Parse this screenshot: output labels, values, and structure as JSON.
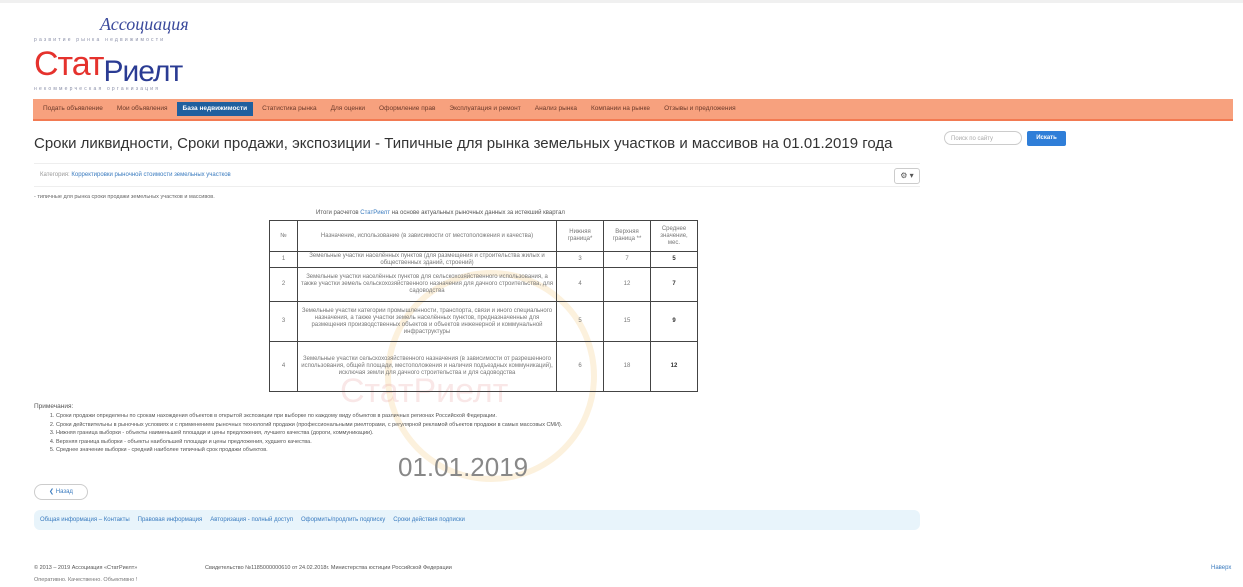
{
  "logo": {
    "association": "Ассоциация",
    "tagline_top": "развитие рынка недвижимости",
    "brand_part1": "Стат",
    "brand_part2": "Риелт",
    "tagline_bottom": "некоммерческая организация"
  },
  "nav": {
    "items": [
      {
        "label": "Подать объявление",
        "active": false
      },
      {
        "label": "Мои объявления",
        "active": false
      },
      {
        "label": "База недвижимости",
        "active": true
      },
      {
        "label": "Статистика рынка",
        "active": false
      },
      {
        "label": "Для оценки",
        "active": false
      },
      {
        "label": "Оформление прав",
        "active": false
      },
      {
        "label": "Эксплуатация и ремонт",
        "active": false
      },
      {
        "label": "Анализ рынка",
        "active": false
      },
      {
        "label": "Компании на рынке",
        "active": false
      },
      {
        "label": "Отзывы и предложения",
        "active": false
      }
    ]
  },
  "page": {
    "title": "Сроки ликвидности, Сроки продажи, экспозиции - Типичные для рынка земельных участков и массивов на 01.01.2019 года",
    "search_placeholder": "Поиск по сайту",
    "search_button": "Искать",
    "category_label": "Категория:",
    "category_link": "Корректировки рыночной стоимости земельных участков",
    "gear": "⚙ ▾",
    "intro": "- типичные для рынка сроки продажи земельных участков и массивов.",
    "caption_prefix": "Итоги расчетов",
    "caption_brand": "СтатРиелт",
    "caption_suffix": "на основе актуальных рыночных данных за истекший квартал"
  },
  "table": {
    "headers": {
      "num": "№",
      "desc": "Назначение, использование (в зависимости от местоположения и качества)",
      "lower": "Нижняя граница*",
      "upper": "Верхняя граница **",
      "avg": "Среднее значение, мес."
    },
    "rows": [
      {
        "num": "1",
        "desc": "Земельные участки населённых пунктов (для размещения и строительства жилых и общественных зданий, строений)",
        "lower": "3",
        "upper": "7",
        "avg": "5"
      },
      {
        "num": "2",
        "desc": "Земельные участки населённых пунктов для сельскохозяйственного использования, а также участки земель сельскохозяйственного назначения для дачного строительства, для садоводства",
        "lower": "4",
        "upper": "12",
        "avg": "7"
      },
      {
        "num": "3",
        "desc": "Земельные участки категории промышленности, транспорта, связи и иного специального назначения, а также участки земель населённых пунктов, предназначенные для размещения производственных объектов и объектов инженерной и коммунальной инфраструктуры",
        "lower": "5",
        "upper": "15",
        "avg": "9"
      },
      {
        "num": "4",
        "desc": "Земельные участки сельскохозяйственного назначения (в зависимости от разрешенного использования, общей площади, местоположения и наличия подъездных коммуникаций), исключая земли для дачного строительства и для садоводства",
        "lower": "6",
        "upper": "18",
        "avg": "12"
      }
    ]
  },
  "watermark": {
    "text": "СтатРиелт",
    "date": "01.01.2019"
  },
  "notes": {
    "title": "Примечания:",
    "items": [
      "Сроки продажи определены по срокам нахождения объектов в открытой экспозиции при выборке по каждому виду объектов в различных регионах Российской Федерации.",
      "Сроки действительны в рыночных условиях и с применением рыночных технологий продажи (профессиональными риелторами, с регулярной рекламой объектов продажи в самых массовых СМИ).",
      "Нижняя граница выборки - объекты наименьшей площади и цены предложения, лучшего качества (дороги, коммуникации).",
      "Верхняя граница выборки - объекты наибольшей площади и цены предложения, худшего качества.",
      "Среднее значение выборки - средний наиболее типичный срок продажи объектов."
    ]
  },
  "back_button": "❮ Назад",
  "footer": {
    "links": [
      "Общая информация – Контакты",
      "Правовая информация",
      "Авторизация - полный доступ",
      "Оформить/продлить подписку",
      "Сроки действия подписки"
    ],
    "copyright": "© 2013 – 2019 Ассоциация «СтатРиелт»",
    "certificate": "Свидетельство №1185000000610 от 24.02.2018г. Министерства юстиции Российской Федерации",
    "slogan": "Оперативно. Качественно. Объективно !",
    "to_top": "Наверх"
  }
}
